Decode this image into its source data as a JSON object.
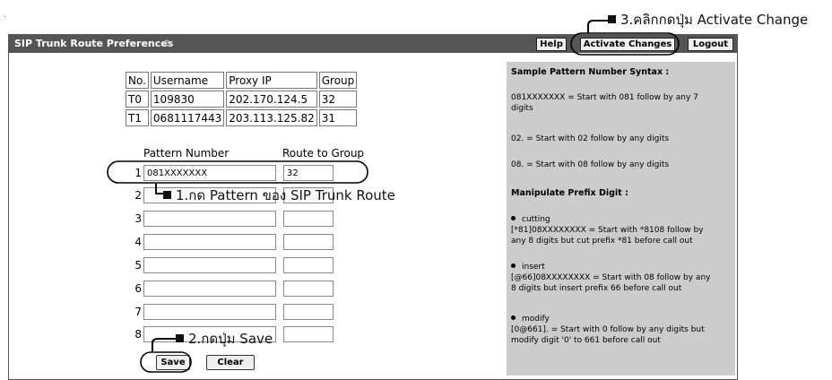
{
  "window": {
    "title": "SIP Trunk Route Preferences",
    "title_icon": "refresh-icon"
  },
  "toolbar": {
    "help_label": "Help",
    "activate_label": "Activate Changes",
    "logout_label": "Logout"
  },
  "trunk_table": {
    "headers": [
      "No.",
      "Username",
      "Proxy IP",
      "Group"
    ],
    "rows": [
      [
        "T0",
        "109830",
        "202.170.124.5",
        "32"
      ],
      [
        "T1",
        "0681117443",
        "203.113.125.82",
        "31"
      ]
    ]
  },
  "pattern_form": {
    "pattern_header": "Pattern Number",
    "group_header": "Route to Group",
    "rows": [
      {
        "num": "1",
        "pattern": "081XXXXXXX",
        "group": "32"
      },
      {
        "num": "2",
        "pattern": "",
        "group": ""
      },
      {
        "num": "3",
        "pattern": "",
        "group": ""
      },
      {
        "num": "4",
        "pattern": "",
        "group": ""
      },
      {
        "num": "5",
        "pattern": "",
        "group": ""
      },
      {
        "num": "6",
        "pattern": "",
        "group": ""
      },
      {
        "num": "7",
        "pattern": "",
        "group": ""
      },
      {
        "num": "8",
        "pattern": "",
        "group": ""
      }
    ],
    "save_label": "Save",
    "clear_label": "Clear"
  },
  "help_panel": {
    "syntax_title": "Sample Pattern Number Syntax :",
    "ex1_a": "081XXXXXXX = Start with 081 follow by any 7",
    "ex1_b": "digits",
    "ex2": "02. = Start with 02 follow by any digits",
    "ex3": "08. = Start with 08 follow by any digits",
    "manip_title": "Manipulate Prefix Digit :",
    "cut_title": "cutting",
    "cut_a": "[*81]08XXXXXXXX = Start with *8108 follow by",
    "cut_b": "any 8 digits but cut prefix *81 before call out",
    "ins_title": "insert",
    "ins_a": "[@66]08XXXXXXXX = Start with 08 follow by any",
    "ins_b": "8 digits but insert prefix 66 before call out",
    "mod_title": "modify",
    "mod_a": "[0@661]. = Start with 0 follow by any digits but",
    "mod_b": "modify digit '0' to 661 before call out"
  },
  "annotations": {
    "step1": "1.กด Pattern ของ SIP Trunk Route",
    "step2": "2.กดปุ่ม Save",
    "step3": "3.คลิกกดปุ่ม Activate Change"
  }
}
